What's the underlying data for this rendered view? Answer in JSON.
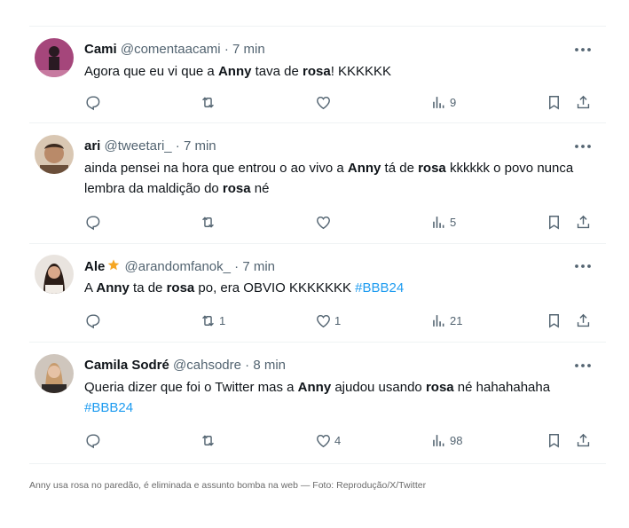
{
  "tweets": [
    {
      "name": "Cami",
      "handle": "@comentaacami",
      "time": "· 7 min",
      "text_1": "Agora que eu vi que a ",
      "bold_1": "Anny",
      "text_2": " tava de ",
      "bold_2": "rosa",
      "text_3": "! KKKKKK",
      "views": "9"
    },
    {
      "name": "ari",
      "handle": "@tweetari_",
      "time": "· 7 min",
      "text_1": "ainda pensei na hora que entrou o ao vivo a ",
      "bold_1": "Anny",
      "text_2": " tá de ",
      "bold_2": "rosa",
      "text_3": " kkkkkk o povo nunca lembra da maldição do ",
      "bold_3": "rosa",
      "text_4": " né",
      "views": "5"
    },
    {
      "name": "Ale",
      "handle": "@arandomfanok_",
      "time": "· 7 min",
      "text_1": "A ",
      "bold_1": "Anny",
      "text_2": " ta de ",
      "bold_2": "rosa",
      "text_3": " po, era OBVIO KKKKKKK ",
      "hashtag": "#BBB24",
      "retweets": "1",
      "likes": "1",
      "views": "21"
    },
    {
      "name": "Camila Sodré",
      "handle": "@cahsodre",
      "time": "· 8 min",
      "text_1": "Queria dizer que foi o Twitter mas a ",
      "bold_1": "Anny",
      "text_2": " ajudou usando ",
      "bold_2": "rosa",
      "text_3": " né hahahahaha ",
      "hashtag": "#BBB24",
      "likes": "4",
      "views": "98"
    }
  ],
  "caption": "Anny usa rosa no paredão, é eliminada e assunto bomba na web — Foto: Reprodução/X/Twitter",
  "colors": {
    "text": "#0f1419",
    "secondary": "#536471",
    "link": "#1d9bf0",
    "border": "#eff3f4",
    "star": "#f5a623"
  },
  "icons": [
    "reply-icon",
    "retweet-icon",
    "like-icon",
    "views-icon",
    "bookmark-icon",
    "share-icon",
    "more-icon",
    "star-icon"
  ]
}
